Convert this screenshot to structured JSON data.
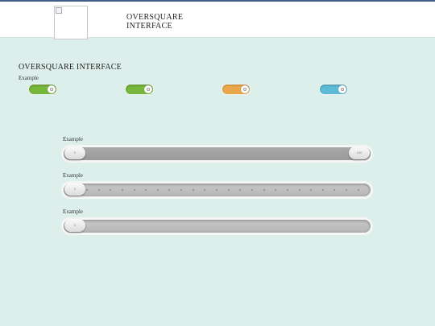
{
  "header": {
    "brand_line1": "OVERSQUARE",
    "brand_line2": "INTERFACE"
  },
  "section": {
    "title": "OVERSQUARE INTERFACE",
    "subtitle": "Example"
  },
  "toggles": [
    {
      "name": "toggle-green-1",
      "color": "#77b73b",
      "state": "on"
    },
    {
      "name": "toggle-green-2",
      "color": "#77b73b",
      "state": "on"
    },
    {
      "name": "toggle-orange",
      "color": "#eba84a",
      "state": "on"
    },
    {
      "name": "toggle-blue",
      "color": "#5dbbd7",
      "state": "on"
    }
  ],
  "sliders": [
    {
      "label": "Example",
      "type": "range",
      "min_label": "0",
      "max_label": "100",
      "value_from": 0,
      "value_to": 100
    },
    {
      "label": "Example",
      "type": "stepped",
      "min_label": "0",
      "value": 0,
      "steps": 24
    },
    {
      "label": "Example",
      "type": "single",
      "min_label": "0",
      "value": 0
    }
  ],
  "colors": {
    "background": "#ddefeb",
    "header_border": "#3f5f86"
  }
}
